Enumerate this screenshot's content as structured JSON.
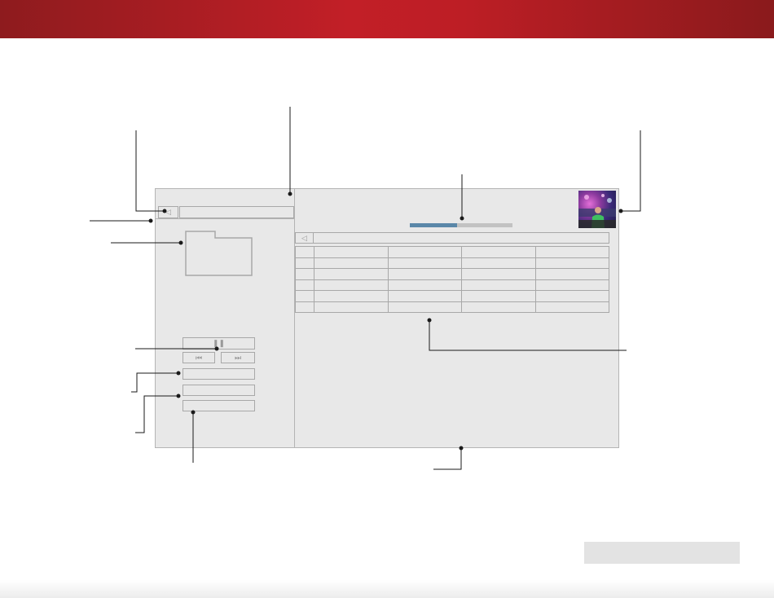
{
  "header": {
    "color_left": "#8e1b1e",
    "color_center": "#c21f27"
  },
  "player": {
    "back_icon": "triangle-left-icon",
    "path_bar_value": "",
    "folder_icon": "folder-icon",
    "play_pause_icon": "pause-icon",
    "prev_icon": "skip-back-icon",
    "next_icon": "skip-forward-icon",
    "pause_glyph": "❚❚",
    "prev_glyph": "⏮",
    "next_glyph": "⏭",
    "back_glyph": "◁",
    "option_buttons": [
      "",
      "",
      ""
    ],
    "progress_fraction": 0.46,
    "album_art_icon": "album-art-image",
    "list_back_glyph": "◁",
    "playlist_rows": 6,
    "playlist_columns": 5
  },
  "footer": {
    "page_indicator": ""
  }
}
